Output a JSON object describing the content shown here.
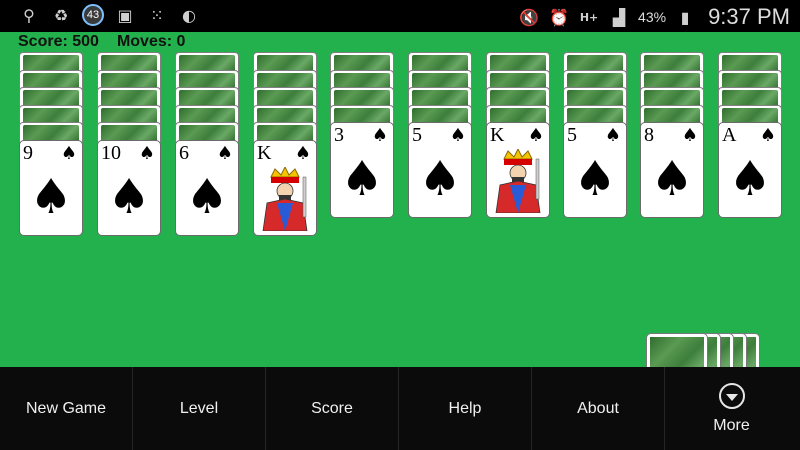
{
  "status_bar": {
    "left_icons": [
      "usb-icon",
      "recycle-icon",
      "notification-count-badge",
      "image-icon",
      "bbm-icon",
      "unknown-app-icon"
    ],
    "notification_count": "43",
    "right_icons": [
      "mute-icon",
      "alarm-icon",
      "h-plus-network-icon",
      "signal-icon",
      "battery-icon"
    ],
    "network_label": "H+",
    "battery_percent": "43%",
    "time": "9:37 PM"
  },
  "game": {
    "score_text": "Score: 500",
    "moves_text": "Moves: 0"
  },
  "tableau": [
    {
      "face_down": 5,
      "top": {
        "rank": "9",
        "suit": "♠"
      }
    },
    {
      "face_down": 5,
      "top": {
        "rank": "10",
        "suit": "♠"
      }
    },
    {
      "face_down": 5,
      "top": {
        "rank": "6",
        "suit": "♠"
      }
    },
    {
      "face_down": 5,
      "top": {
        "rank": "K",
        "suit": "♠"
      }
    },
    {
      "face_down": 4,
      "top": {
        "rank": "3",
        "suit": "♠"
      }
    },
    {
      "face_down": 4,
      "top": {
        "rank": "5",
        "suit": "♠"
      }
    },
    {
      "face_down": 4,
      "top": {
        "rank": "K",
        "suit": "♠"
      }
    },
    {
      "face_down": 4,
      "top": {
        "rank": "5",
        "suit": "♠"
      }
    },
    {
      "face_down": 4,
      "top": {
        "rank": "8",
        "suit": "♠"
      }
    },
    {
      "face_down": 4,
      "top": {
        "rank": "A",
        "suit": "♠"
      }
    }
  ],
  "stock": {
    "piles_remaining": 5
  },
  "menu": {
    "new_game": "New Game",
    "level": "Level",
    "score": "Score",
    "help": "Help",
    "about": "About",
    "more": "More"
  }
}
